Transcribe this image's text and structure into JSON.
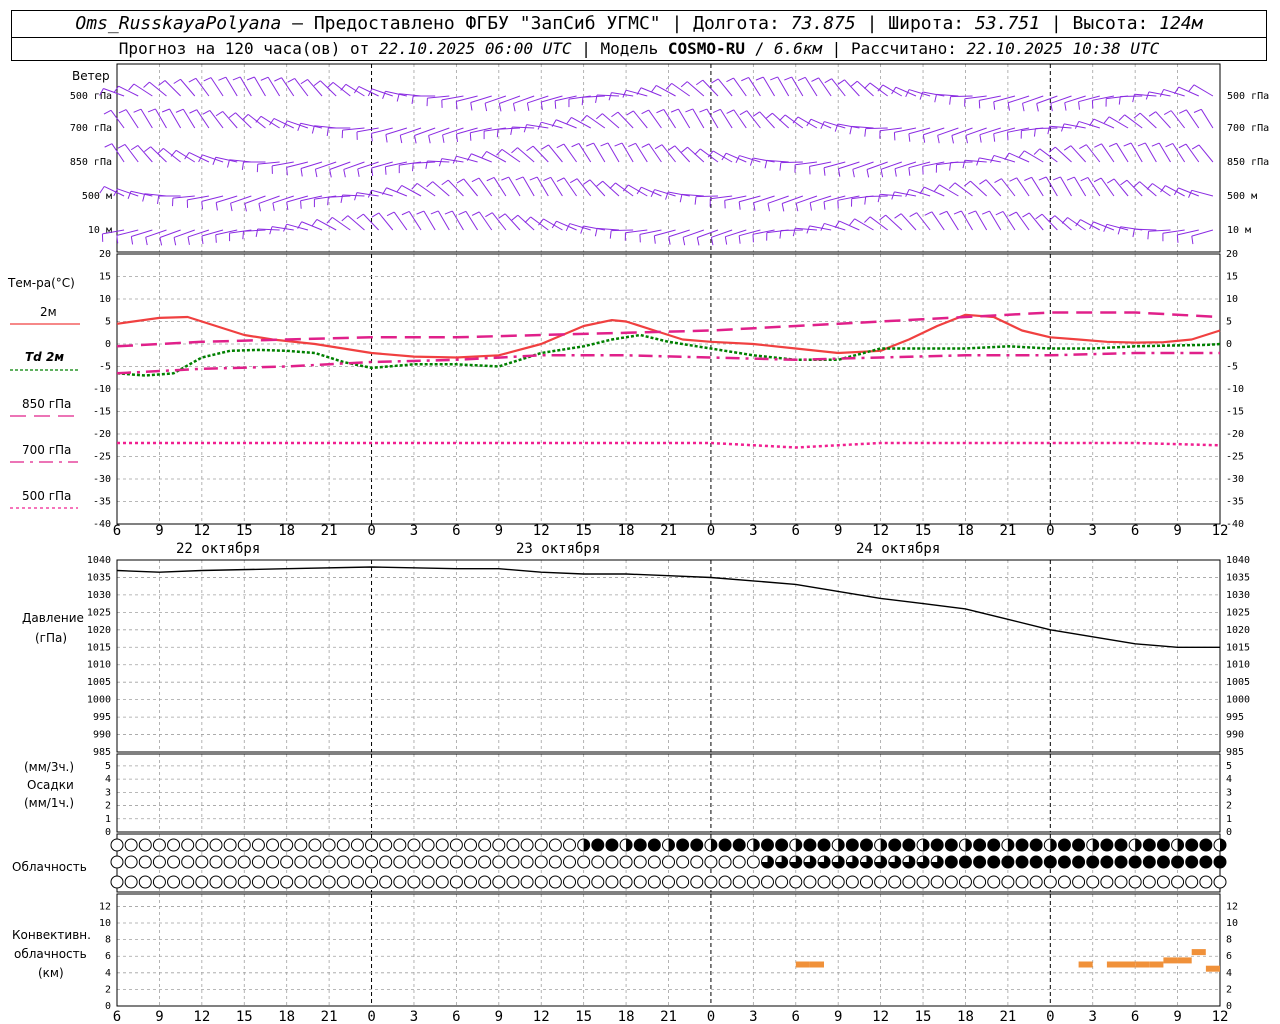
{
  "header": {
    "station": "Oms_RusskayaPolyana",
    "provider": "Предоставлено ФГБУ \"ЗапСиб УГМС\"",
    "lon_label": "Долгота:",
    "lon": "73.875",
    "lat_label": "Широта:",
    "lat": "53.751",
    "alt_label": "Высота:",
    "alt": "124м",
    "forecast": "Прогноз на 120 часа(ов) от",
    "init_time": "22.10.2025 06:00 UTC",
    "model_label": "Модель",
    "model": "COSMO-RU",
    "resolution": "6.6км",
    "calc_label": "Рассчитано:",
    "calc_time": "22.10.2025 10:38 UTC"
  },
  "colors": {
    "wind": "#8a2be2",
    "t2m": "#f04040",
    "td2m": "#008000",
    "t850": "#e0208a",
    "t700": "#e0208a",
    "t500": "#f02090",
    "pressure": "#000000",
    "conv": "#f0913a",
    "grid": "#a0a0a0"
  },
  "panels": {
    "wind": {
      "title": "Ветер",
      "levels": [
        "500 гПа",
        "700 гПа",
        "850 гПа",
        "500 м",
        "10 м"
      ]
    },
    "temp": {
      "title": "Тем-ра(°C)",
      "legend": [
        {
          "key": "t2m",
          "label": "2м",
          "style": "solid"
        },
        {
          "key": "td2m",
          "label": "Td  2м",
          "style": "dotted"
        },
        {
          "key": "t850",
          "label": "850 гПа",
          "style": "dashed"
        },
        {
          "key": "t700",
          "label": "700 гПа",
          "style": "dashdot"
        },
        {
          "key": "t500",
          "label": "500 гПа",
          "style": "dotted"
        }
      ]
    },
    "pressure": {
      "label1": "Давление",
      "label2": "(гПа)"
    },
    "precip": {
      "label1": "(мм/3ч.)",
      "label2": "Осадки",
      "label3": "(мм/1ч.)"
    },
    "cloud": {
      "label": "Облачность"
    },
    "conv": {
      "label1": "Конвективн.",
      "label2": "облачность",
      "label3": "(км)"
    }
  },
  "time_axis": {
    "hour_labels": [
      "6",
      "9",
      "12",
      "15",
      "18",
      "21",
      "0",
      "3",
      "6",
      "9",
      "12",
      "15",
      "18",
      "21",
      "0",
      "3",
      "6",
      "9",
      "12",
      "15",
      "18",
      "21",
      "0",
      "3",
      "6",
      "9",
      "12"
    ],
    "day_labels": [
      "22 октября",
      "23 октября",
      "24 октября"
    ]
  },
  "chart_data": [
    {
      "type": "line",
      "title": "Тем-ра(°C)",
      "ylim": [
        -40,
        20
      ],
      "yticks": [
        20,
        15,
        10,
        5,
        0,
        -5,
        -10,
        -15,
        -20,
        -25,
        -30,
        -35,
        -40
      ],
      "xlim_hours": [
        0,
        78
      ],
      "series": [
        {
          "name": "2м",
          "x": [
            0,
            3,
            5,
            7,
            9,
            11,
            14,
            18,
            21,
            24,
            27,
            30,
            33,
            35,
            36,
            38,
            40,
            42,
            45,
            48,
            51,
            54,
            56,
            58,
            60,
            62,
            64,
            66,
            68,
            70,
            72,
            74,
            76,
            78
          ],
          "values": [
            4.5,
            5.8,
            6,
            4,
            2,
            1,
            0,
            -2,
            -2.8,
            -3,
            -2.5,
            0,
            4,
            5.3,
            5,
            3,
            1,
            0.5,
            0,
            -1,
            -2,
            -1.5,
            1,
            4,
            6.5,
            6,
            3,
            1.5,
            1,
            0.5,
            0.3,
            0.4,
            1,
            3
          ]
        },
        {
          "name": "Td  2м",
          "x": [
            0,
            2,
            4,
            6,
            8,
            10,
            12,
            14,
            16,
            18,
            21,
            24,
            27,
            30,
            33,
            35,
            37,
            39,
            41,
            43,
            45,
            48,
            51,
            54,
            57,
            60,
            63,
            66,
            69,
            72,
            75,
            77,
            78
          ],
          "values": [
            -6.5,
            -7,
            -6.5,
            -3,
            -1.5,
            -1.3,
            -1.5,
            -2,
            -4,
            -5.3,
            -4.5,
            -4.5,
            -5,
            -2,
            -0.5,
            1,
            2,
            0.5,
            -0.5,
            -1.5,
            -2.5,
            -3.5,
            -3.5,
            -1,
            -1,
            -1,
            -0.5,
            -1,
            -1,
            -0.5,
            -0.3,
            -0.2,
            0
          ]
        },
        {
          "name": "850 гПа",
          "x": [
            0,
            6,
            12,
            18,
            24,
            30,
            36,
            42,
            48,
            54,
            60,
            66,
            72,
            78
          ],
          "values": [
            -0.5,
            0.5,
            1,
            1.5,
            1.5,
            2,
            2.5,
            3,
            4,
            5,
            6,
            7,
            7,
            6
          ]
        },
        {
          "name": "700 гПа",
          "x": [
            0,
            6,
            12,
            18,
            24,
            30,
            36,
            42,
            48,
            54,
            60,
            66,
            72,
            78
          ],
          "values": [
            -6.5,
            -5.5,
            -5,
            -4,
            -3.5,
            -2.5,
            -2.5,
            -3,
            -3.5,
            -3,
            -2.5,
            -2.5,
            -2,
            -2
          ]
        },
        {
          "name": "500 гПа",
          "x": [
            0,
            6,
            12,
            18,
            24,
            30,
            36,
            42,
            48,
            54,
            60,
            66,
            72,
            78
          ],
          "values": [
            -22,
            -22,
            -22,
            -22,
            -22,
            -22,
            -22,
            -22,
            -23,
            -22,
            -22,
            -22,
            -22,
            -22.5
          ]
        }
      ]
    },
    {
      "type": "line",
      "title": "Давление",
      "ylim": [
        985,
        1040
      ],
      "yticks": [
        1040,
        1035,
        1030,
        1025,
        1020,
        1015,
        1010,
        1005,
        1000,
        995,
        990,
        985
      ],
      "series": [
        {
          "name": "Давление",
          "x": [
            0,
            3,
            6,
            12,
            18,
            24,
            27,
            30,
            33,
            36,
            39,
            42,
            45,
            48,
            51,
            54,
            57,
            60,
            63,
            66,
            69,
            72,
            75,
            78
          ],
          "values": [
            1037,
            1036.5,
            1037,
            1037.5,
            1038,
            1037.5,
            1037.5,
            1036.5,
            1036,
            1036,
            1035.5,
            1035,
            1034,
            1033,
            1031,
            1029,
            1027.5,
            1026,
            1023,
            1020,
            1018,
            1016,
            1015,
            1015
          ]
        }
      ]
    },
    {
      "type": "bar",
      "title": "Осадки",
      "ylim": [
        0,
        5
      ],
      "yticks": [
        5,
        4,
        3,
        2,
        1,
        0
      ],
      "series": [
        {
          "name": "Осадки",
          "values": []
        }
      ]
    },
    {
      "type": "bar",
      "title": "Конвективн. облачность",
      "ylim": [
        0,
        13
      ],
      "yticks": [
        12,
        10,
        8,
        6,
        4,
        2,
        0
      ],
      "series": [
        {
          "name": "Конвективн. облачность",
          "x": [
            49,
            50,
            69,
            71,
            72,
            73,
            74,
            75,
            76,
            77,
            78
          ],
          "values": [
            5,
            5,
            5,
            5,
            5,
            5,
            5,
            5.5,
            5.5,
            6.5,
            4.5
          ]
        }
      ]
    }
  ]
}
